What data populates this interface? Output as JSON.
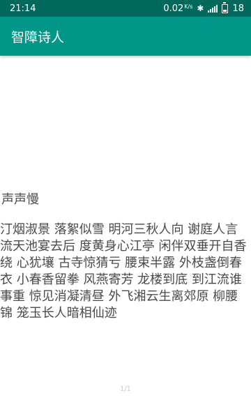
{
  "status_bar": {
    "time": "21:14",
    "net_speed": "0.02",
    "net_unit": "K/s",
    "battery": "18",
    "icons": [
      "bluetooth-icon",
      "signal-icon",
      "battery-icon"
    ]
  },
  "app_bar": {
    "title": "智障诗人",
    "color": "#009688",
    "status_color": "#00695c"
  },
  "poem": {
    "title": "声声慢",
    "body": "汀烟淑景 落絮似雪 明河三秋人向 谢庭人言 流天池宴去后 度黄身心江亭 闲伴双垂开自香绕 心犹壤 古寺惊猜亏 腰束半露 外枝盏倒春衣 小春香留拳 风燕寄芳 龙楼到底 到江流谁事重 惊见消凝清昼 外飞湘云生离郊原 柳腰锦 笼玉长人暗相仙迹"
  },
  "page_indicator": "1/1"
}
